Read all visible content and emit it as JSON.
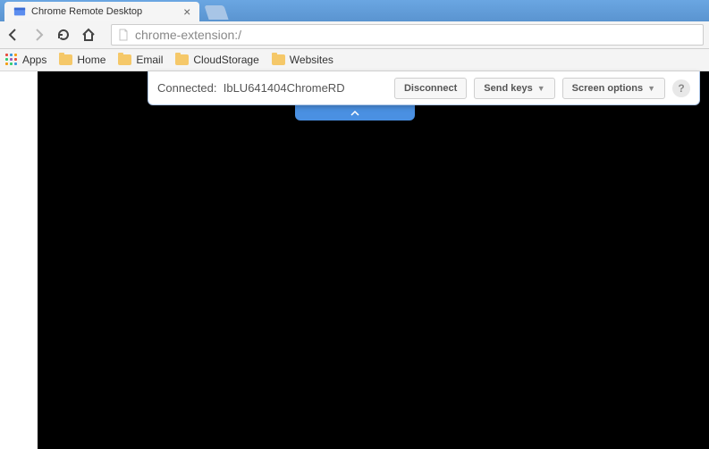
{
  "tab": {
    "title": "Chrome Remote Desktop"
  },
  "url": "chrome-extension:/",
  "apps_label": "Apps",
  "bookmarks": [
    {
      "label": "Home"
    },
    {
      "label": "Email"
    },
    {
      "label": "CloudStorage"
    },
    {
      "label": "Websites"
    }
  ],
  "connection": {
    "status_prefix": "Connected:",
    "host": "IbLU641404ChromeRD",
    "disconnect": "Disconnect",
    "send_keys": "Send keys",
    "screen_options": "Screen options"
  }
}
